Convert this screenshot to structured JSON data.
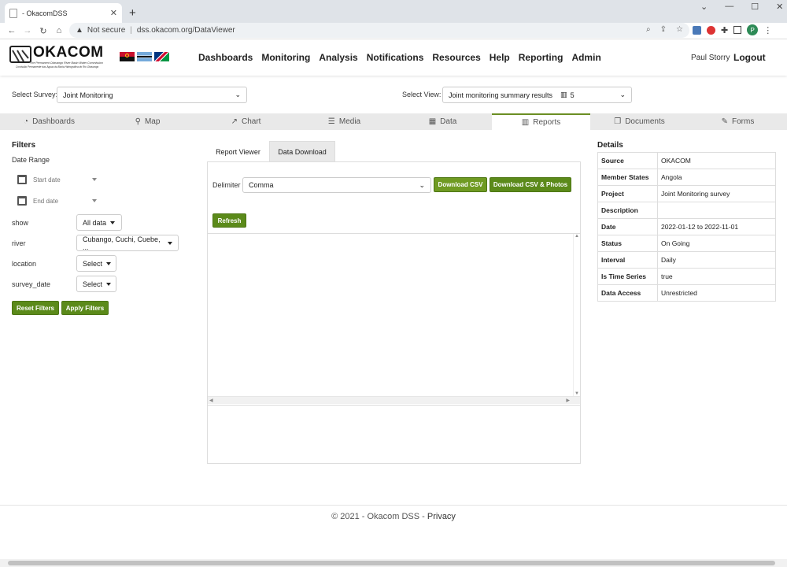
{
  "browser": {
    "tab_title": "- OkacomDSS",
    "security": "Not secure",
    "url": "dss.okacom.org/DataViewer",
    "profile_initial": "P"
  },
  "brand": {
    "name": "OKACOM",
    "tagline_en": "The Permanent Okavango River Basin Water Commission",
    "tagline_pt": "Comissão Permanente das Águas da Bacia Hidrográfica do Rio Okavango"
  },
  "nav": [
    "Dashboards",
    "Monitoring",
    "Analysis",
    "Notifications",
    "Resources",
    "Help",
    "Reporting",
    "Admin"
  ],
  "user": {
    "name": "Paul Storry",
    "logout": "Logout"
  },
  "survey": {
    "label": "Select Survey:",
    "value": "Joint Monitoring"
  },
  "view": {
    "label": "Select View:",
    "value": "Joint monitoring summary results",
    "count": "5"
  },
  "tabs": [
    {
      "label": "Dashboards",
      "icon": "dashboard-icon"
    },
    {
      "label": "Map",
      "icon": "map-marker-icon"
    },
    {
      "label": "Chart",
      "icon": "line-chart-icon"
    },
    {
      "label": "Media",
      "icon": "list-icon"
    },
    {
      "label": "Data",
      "icon": "table-icon"
    },
    {
      "label": "Reports",
      "icon": "bar-chart-icon"
    },
    {
      "label": "Documents",
      "icon": "documents-icon"
    },
    {
      "label": "Forms",
      "icon": "edit-icon"
    }
  ],
  "filters": {
    "title": "Filters",
    "date_range": "Date Range",
    "start_placeholder": "Start date",
    "end_placeholder": "End date",
    "rows": [
      {
        "label": "show",
        "value": "All data"
      },
      {
        "label": "river",
        "value": "Cubango, Cuchi, Cuebe, ..."
      },
      {
        "label": "location",
        "value": "Select"
      },
      {
        "label": "survey_date",
        "value": "Select"
      }
    ],
    "reset": "Reset Filters",
    "apply": "Apply Filters"
  },
  "subtabs": {
    "report_viewer": "Report Viewer",
    "data_download": "Data Download"
  },
  "download": {
    "delimiter_label": "Delimiter",
    "delimiter_value": "Comma",
    "csv": "Download CSV",
    "csv_photos": "Download CSV & Photos",
    "refresh": "Refresh"
  },
  "details": {
    "title": "Details",
    "rows": [
      {
        "k": "Source",
        "v": "OKACOM"
      },
      {
        "k": "Member States",
        "v": "Angola"
      },
      {
        "k": "Project",
        "v": "Joint Monitoring survey"
      },
      {
        "k": "Description",
        "v": ""
      },
      {
        "k": "Date",
        "v": "2022-01-12 to 2022-11-01"
      },
      {
        "k": "Status",
        "v": "On Going"
      },
      {
        "k": "Interval",
        "v": "Daily"
      },
      {
        "k": "Is Time Series",
        "v": "true"
      },
      {
        "k": "Data Access",
        "v": "Unrestricted"
      }
    ]
  },
  "footer": {
    "copyright": "© 2021 - Okacom DSS - ",
    "privacy": "Privacy"
  }
}
